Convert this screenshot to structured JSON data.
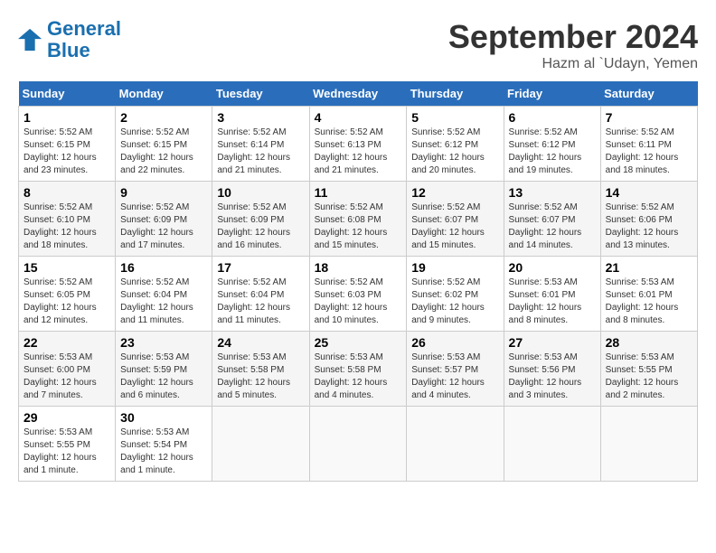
{
  "logo": {
    "line1": "General",
    "line2": "Blue"
  },
  "title": "September 2024",
  "location": "Hazm al `Udayn, Yemen",
  "days_header": [
    "Sunday",
    "Monday",
    "Tuesday",
    "Wednesday",
    "Thursday",
    "Friday",
    "Saturday"
  ],
  "weeks": [
    [
      {
        "day": "1",
        "info": "Sunrise: 5:52 AM\nSunset: 6:15 PM\nDaylight: 12 hours and 23 minutes."
      },
      {
        "day": "2",
        "info": "Sunrise: 5:52 AM\nSunset: 6:15 PM\nDaylight: 12 hours and 22 minutes."
      },
      {
        "day": "3",
        "info": "Sunrise: 5:52 AM\nSunset: 6:14 PM\nDaylight: 12 hours and 21 minutes."
      },
      {
        "day": "4",
        "info": "Sunrise: 5:52 AM\nSunset: 6:13 PM\nDaylight: 12 hours and 21 minutes."
      },
      {
        "day": "5",
        "info": "Sunrise: 5:52 AM\nSunset: 6:12 PM\nDaylight: 12 hours and 20 minutes."
      },
      {
        "day": "6",
        "info": "Sunrise: 5:52 AM\nSunset: 6:12 PM\nDaylight: 12 hours and 19 minutes."
      },
      {
        "day": "7",
        "info": "Sunrise: 5:52 AM\nSunset: 6:11 PM\nDaylight: 12 hours and 18 minutes."
      }
    ],
    [
      {
        "day": "8",
        "info": "Sunrise: 5:52 AM\nSunset: 6:10 PM\nDaylight: 12 hours and 18 minutes."
      },
      {
        "day": "9",
        "info": "Sunrise: 5:52 AM\nSunset: 6:09 PM\nDaylight: 12 hours and 17 minutes."
      },
      {
        "day": "10",
        "info": "Sunrise: 5:52 AM\nSunset: 6:09 PM\nDaylight: 12 hours and 16 minutes."
      },
      {
        "day": "11",
        "info": "Sunrise: 5:52 AM\nSunset: 6:08 PM\nDaylight: 12 hours and 15 minutes."
      },
      {
        "day": "12",
        "info": "Sunrise: 5:52 AM\nSunset: 6:07 PM\nDaylight: 12 hours and 15 minutes."
      },
      {
        "day": "13",
        "info": "Sunrise: 5:52 AM\nSunset: 6:07 PM\nDaylight: 12 hours and 14 minutes."
      },
      {
        "day": "14",
        "info": "Sunrise: 5:52 AM\nSunset: 6:06 PM\nDaylight: 12 hours and 13 minutes."
      }
    ],
    [
      {
        "day": "15",
        "info": "Sunrise: 5:52 AM\nSunset: 6:05 PM\nDaylight: 12 hours and 12 minutes."
      },
      {
        "day": "16",
        "info": "Sunrise: 5:52 AM\nSunset: 6:04 PM\nDaylight: 12 hours and 11 minutes."
      },
      {
        "day": "17",
        "info": "Sunrise: 5:52 AM\nSunset: 6:04 PM\nDaylight: 12 hours and 11 minutes."
      },
      {
        "day": "18",
        "info": "Sunrise: 5:52 AM\nSunset: 6:03 PM\nDaylight: 12 hours and 10 minutes."
      },
      {
        "day": "19",
        "info": "Sunrise: 5:52 AM\nSunset: 6:02 PM\nDaylight: 12 hours and 9 minutes."
      },
      {
        "day": "20",
        "info": "Sunrise: 5:53 AM\nSunset: 6:01 PM\nDaylight: 12 hours and 8 minutes."
      },
      {
        "day": "21",
        "info": "Sunrise: 5:53 AM\nSunset: 6:01 PM\nDaylight: 12 hours and 8 minutes."
      }
    ],
    [
      {
        "day": "22",
        "info": "Sunrise: 5:53 AM\nSunset: 6:00 PM\nDaylight: 12 hours and 7 minutes."
      },
      {
        "day": "23",
        "info": "Sunrise: 5:53 AM\nSunset: 5:59 PM\nDaylight: 12 hours and 6 minutes."
      },
      {
        "day": "24",
        "info": "Sunrise: 5:53 AM\nSunset: 5:58 PM\nDaylight: 12 hours and 5 minutes."
      },
      {
        "day": "25",
        "info": "Sunrise: 5:53 AM\nSunset: 5:58 PM\nDaylight: 12 hours and 4 minutes."
      },
      {
        "day": "26",
        "info": "Sunrise: 5:53 AM\nSunset: 5:57 PM\nDaylight: 12 hours and 4 minutes."
      },
      {
        "day": "27",
        "info": "Sunrise: 5:53 AM\nSunset: 5:56 PM\nDaylight: 12 hours and 3 minutes."
      },
      {
        "day": "28",
        "info": "Sunrise: 5:53 AM\nSunset: 5:55 PM\nDaylight: 12 hours and 2 minutes."
      }
    ],
    [
      {
        "day": "29",
        "info": "Sunrise: 5:53 AM\nSunset: 5:55 PM\nDaylight: 12 hours and 1 minute."
      },
      {
        "day": "30",
        "info": "Sunrise: 5:53 AM\nSunset: 5:54 PM\nDaylight: 12 hours and 1 minute."
      },
      null,
      null,
      null,
      null,
      null
    ]
  ]
}
